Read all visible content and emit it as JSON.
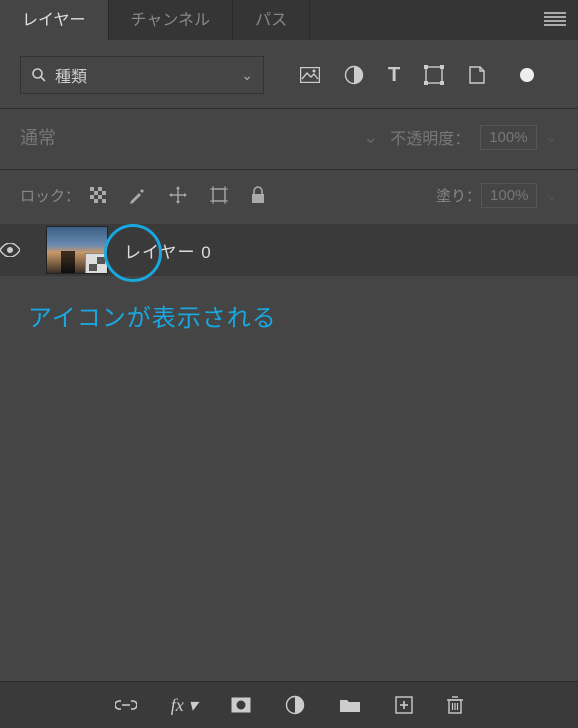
{
  "tabs": {
    "layers": "レイヤー",
    "channels": "チャンネル",
    "paths": "パス"
  },
  "filter": {
    "label": "種類"
  },
  "blend": {
    "mode": "通常",
    "opacity_label": "不透明度：",
    "opacity_value": "100%"
  },
  "lock": {
    "label": "ロック：",
    "fill_label": "塗り：",
    "fill_value": "100%"
  },
  "layer0": {
    "name": "レイヤー 0"
  },
  "annotation": "アイコンが表示される"
}
